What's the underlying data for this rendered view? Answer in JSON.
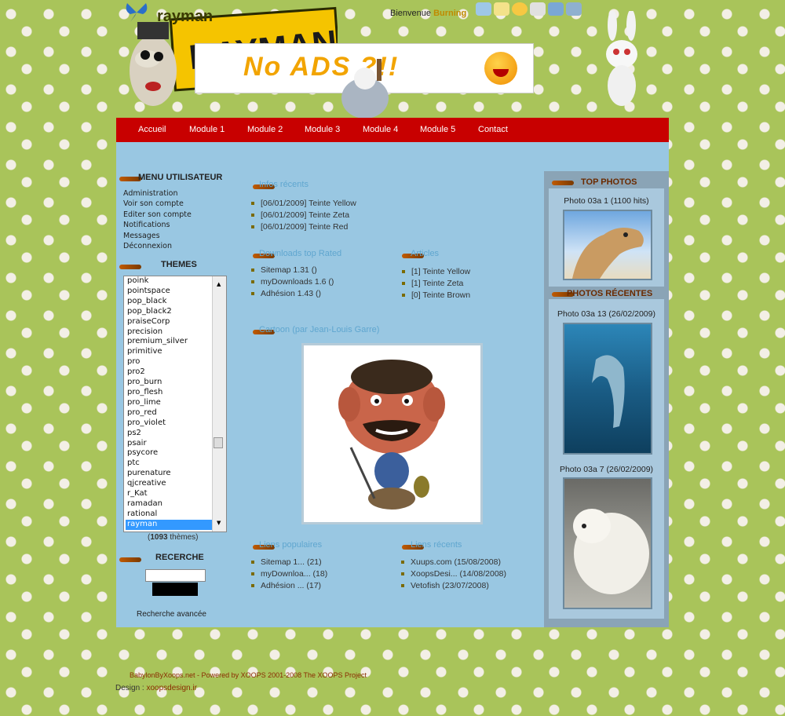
{
  "header": {
    "site_title": "rayman",
    "welcome_prefix": "Bienvenue",
    "welcome_user": "Burning",
    "banner_text": "No ADS ?!!",
    "logo_text": "RAYMAN"
  },
  "nav": [
    "Accueil",
    "Module 1",
    "Module 2",
    "Module 3",
    "Module 4",
    "Module 5",
    "Contact"
  ],
  "user_menu": {
    "title": "MENU UTILISATEUR",
    "items": [
      "Administration",
      "Voir son compte",
      "Editer son compte",
      "Notifications",
      "Messages",
      "Déconnexion"
    ]
  },
  "themes": {
    "title": "THEMES",
    "items": [
      "poink",
      "pointspace",
      "pop_black",
      "pop_black2",
      "praiseCorp",
      "precision",
      "premium_silver",
      "primitive",
      "pro",
      "pro2",
      "pro_burn",
      "pro_flesh",
      "pro_lime",
      "pro_red",
      "pro_violet",
      "ps2",
      "psair",
      "psycore",
      "ptc",
      "purenature",
      "qjcreative",
      "r_Kat",
      "ramadan",
      "rational",
      "rayman"
    ],
    "selected": "rayman",
    "count": "1093",
    "count_suffix": "thèmes"
  },
  "search": {
    "title": "RECERCHE",
    "advanced": "Recherche avancée"
  },
  "recent_news": {
    "title": "Infos récents",
    "items": [
      "[06/01/2009] Teinte Yellow",
      "[06/01/2009] Teinte Zeta",
      "[06/01/2009] Teinte Red"
    ]
  },
  "top_downloads": {
    "title": "Downloads top Rated",
    "items": [
      "Sitemap 1.31 ()",
      "myDownloads 1.6 ()",
      "Adhésion 1.43 ()"
    ]
  },
  "articles": {
    "title": "Articles",
    "items": [
      "[1] Teinte Yellow",
      "[1] Teinte Zeta",
      "[0] Teinte Brown"
    ]
  },
  "cartoon_block": {
    "title": "Cartoon (par Jean-Louis Garre)"
  },
  "popular": {
    "title": "Liens populaires",
    "items": [
      "Sitemap 1... (21)",
      "myDownloa... (18)",
      "Adhésion ... (17)"
    ]
  },
  "recent_links": {
    "title": "Liens récents",
    "items": [
      "Xuups.com (15/08/2008)",
      "XoopsDesi... (14/08/2008)",
      "Vetofish (23/07/2008)"
    ]
  },
  "top_photos": {
    "title": "TOP PHOTOS",
    "caption": "Photo 03a 1 (1100 hits)"
  },
  "recent_photos": {
    "title": "PHOTOS RÉCENTES",
    "items": [
      "Photo 03a 13 (26/02/2009)",
      "Photo 03a 7 (26/02/2009)"
    ]
  },
  "footer": {
    "credits": "BabylonByXoops.net - Powered by XOOPS 2001-2008 The XOOPS Project",
    "design_label": "Design :",
    "design_link": "xoopsdesign.ir"
  },
  "colors": {
    "nav": "#c80000",
    "content": "#99c7e2",
    "page_background": "#a9c45a"
  }
}
